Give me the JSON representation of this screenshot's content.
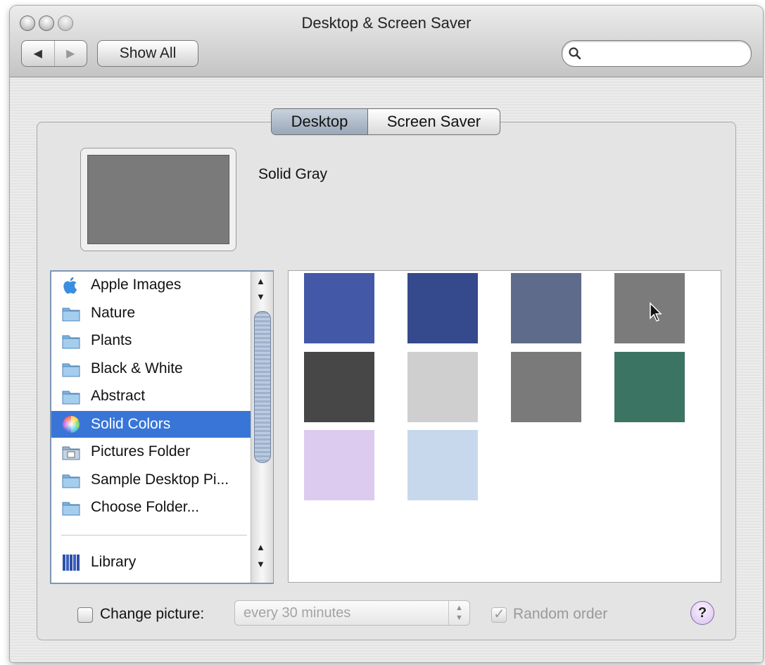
{
  "window": {
    "title": "Desktop & Screen Saver",
    "nav_back": "◀",
    "nav_forward": "▶",
    "show_all": "Show All",
    "search_placeholder": ""
  },
  "tabs": {
    "desktop": "Desktop",
    "screen_saver": "Screen Saver"
  },
  "preview": {
    "name": "Solid Gray",
    "color": "#7a7a7a"
  },
  "sources": [
    {
      "label": "Apple Images",
      "icon": "apple-icon"
    },
    {
      "label": "Nature",
      "icon": "folder-icon"
    },
    {
      "label": "Plants",
      "icon": "folder-icon"
    },
    {
      "label": "Black & White",
      "icon": "folder-icon"
    },
    {
      "label": "Abstract",
      "icon": "folder-icon"
    },
    {
      "label": "Solid Colors",
      "icon": "color-wheel-icon",
      "selected": true
    },
    {
      "label": "Pictures Folder",
      "icon": "pictures-folder-icon"
    },
    {
      "label": "Sample Desktop Pi...",
      "icon": "folder-icon"
    },
    {
      "label": "Choose Folder...",
      "icon": "folder-icon"
    }
  ],
  "library": {
    "label": "Library",
    "icon": "library-icon"
  },
  "swatches": [
    "#4359a7",
    "#354a8c",
    "#5f6b8a",
    "#7b7b7b",
    "#474747",
    "#cfcfcf",
    "#7a7a7a",
    "#3c7463",
    "#dccbee",
    "#c8d8ec"
  ],
  "bottom": {
    "change_picture": "Change picture:",
    "interval": "every 30 minutes",
    "random_order": "Random order",
    "help": "?"
  }
}
